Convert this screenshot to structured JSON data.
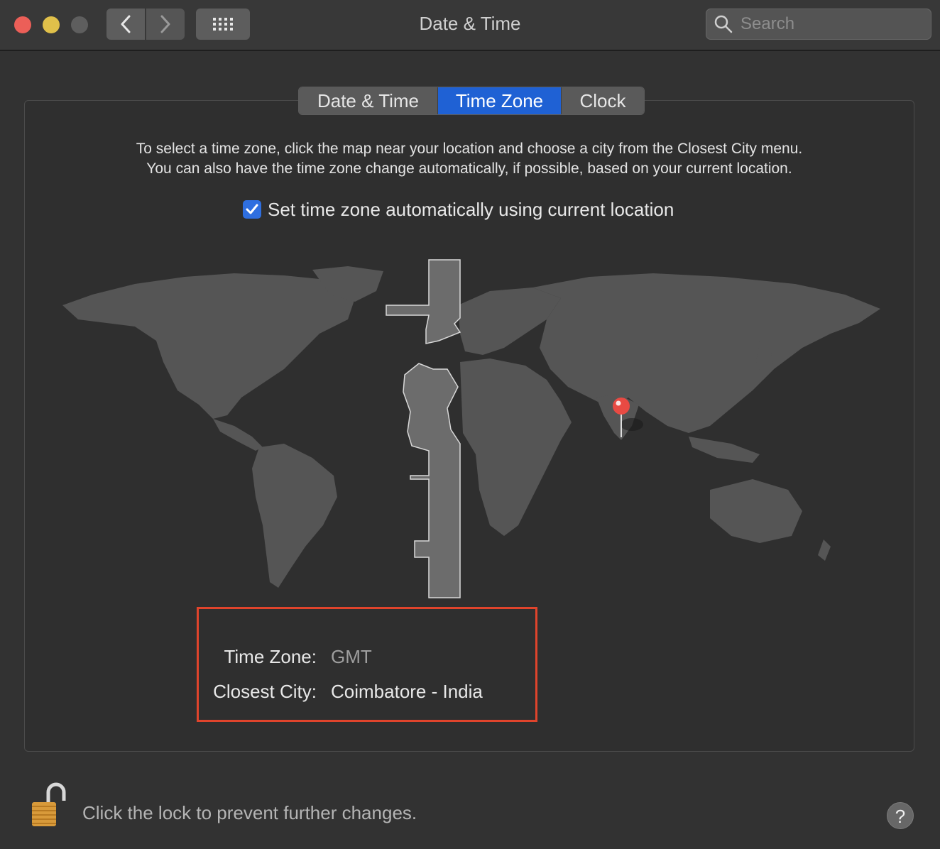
{
  "window": {
    "title": "Date & Time"
  },
  "toolbar": {
    "search_placeholder": "Search"
  },
  "tabs": [
    {
      "label": "Date & Time",
      "selected": false
    },
    {
      "label": "Time Zone",
      "selected": true
    },
    {
      "label": "Clock",
      "selected": false
    }
  ],
  "instructions": {
    "line1": "To select a time zone, click the map near your location and choose a city from the Closest City menu.",
    "line2": "You can also have the time zone change automatically, if possible, based on your current location."
  },
  "auto_timezone": {
    "label": "Set time zone automatically using current location",
    "checked": true
  },
  "info": {
    "timezone_label": "Time Zone:",
    "timezone_value": "GMT",
    "city_label": "Closest City:",
    "city_value": "Coimbatore - India"
  },
  "footer": {
    "lock_text": "Click the lock to prevent further changes.",
    "help_label": "?"
  },
  "colors": {
    "accent": "#1f61d4",
    "highlight_box": "#e0442c",
    "pin": "#e84a43"
  }
}
